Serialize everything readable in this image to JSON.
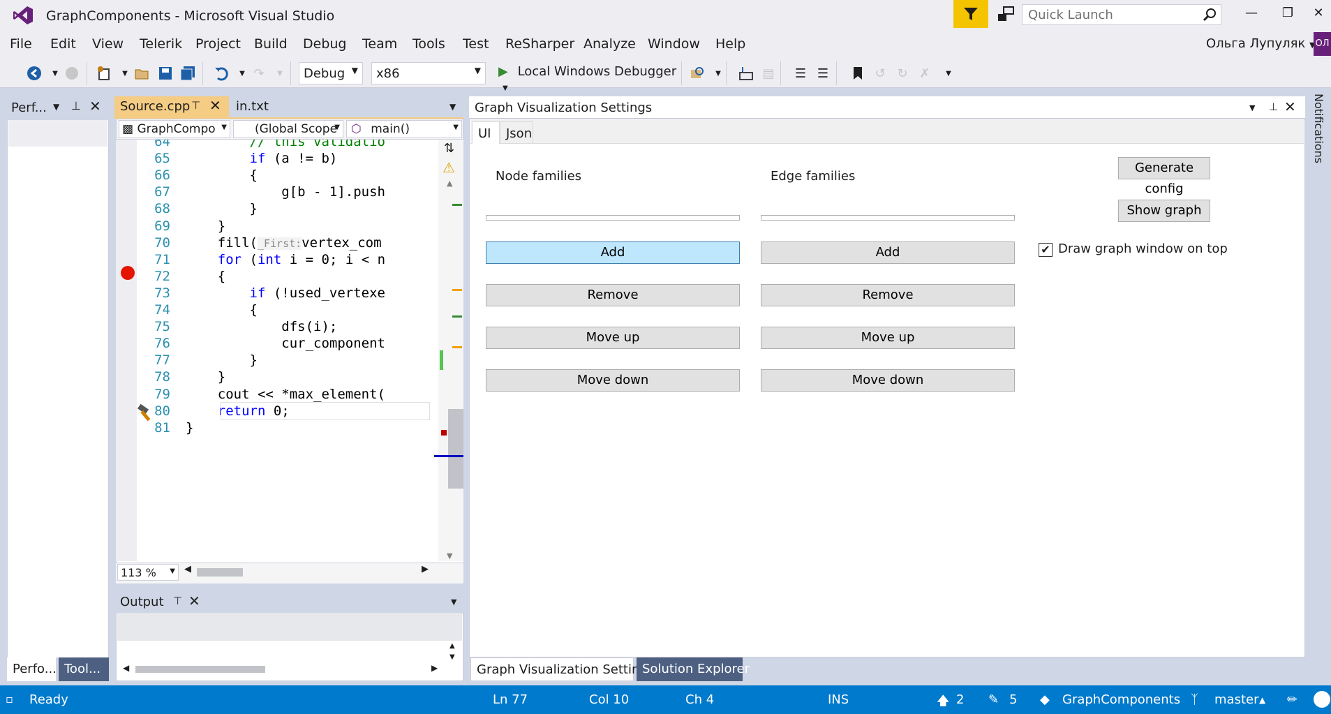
{
  "window": {
    "title": "GraphComponents - Microsoft Visual Studio",
    "quick_launch_placeholder": "Quick Launch",
    "user_name": "Ольга Лупуляк",
    "user_initials": "ОЛ"
  },
  "menu": [
    "File",
    "Edit",
    "View",
    "Telerik",
    "Project",
    "Build",
    "Debug",
    "Team",
    "Tools",
    "Test",
    "ReSharper",
    "Analyze",
    "Window",
    "Help"
  ],
  "toolbar": {
    "config": "Debug",
    "platform": "x86",
    "debugger": "Local Windows Debugger"
  },
  "left_panel": {
    "title": "Perf...",
    "tab_perf": "Perfo...",
    "tab_tool": "Tool..."
  },
  "editor": {
    "tab_active": "Source.cpp",
    "tab_other": "in.txt",
    "nav_project": "GraphCompo",
    "nav_scope": "(Global Scope",
    "nav_member": "main()",
    "zoom": "113 %",
    "lines": [
      {
        "n": "64",
        "code": "        // this validatio"
      },
      {
        "n": "65",
        "code": "        if (a != b)"
      },
      {
        "n": "66",
        "code": "        {"
      },
      {
        "n": "67",
        "code": "            g[b - 1].push"
      },
      {
        "n": "68",
        "code": "        }"
      },
      {
        "n": "69",
        "code": "    }"
      },
      {
        "n": "70",
        "code": "    fill(_First:vertex_com"
      },
      {
        "n": "71",
        "code": "    for (int i = 0; i < n"
      },
      {
        "n": "72",
        "code": "    {"
      },
      {
        "n": "73",
        "code": "        if (!used_vertexe"
      },
      {
        "n": "74",
        "code": "        {"
      },
      {
        "n": "75",
        "code": "            dfs(i);"
      },
      {
        "n": "76",
        "code": "            cur_component"
      },
      {
        "n": "77",
        "code": "        }"
      },
      {
        "n": "78",
        "code": "    }"
      },
      {
        "n": "79",
        "code": "    cout << *max_element("
      },
      {
        "n": "80",
        "code": "    return 0;"
      },
      {
        "n": "81",
        "code": "}"
      }
    ]
  },
  "output": {
    "title": "Output"
  },
  "gvs": {
    "title": "Graph Visualization Settings",
    "tab_ui": "UI",
    "tab_json": "Json",
    "node_families": "Node families",
    "edge_families": "Edge families",
    "add": "Add",
    "remove": "Remove",
    "move_up": "Move up",
    "move_down": "Move down",
    "generate_config": "Generate config",
    "show_graph": "Show graph",
    "draw_on_top": "Draw graph window on top"
  },
  "bottom_tabs": {
    "gvs": "Graph Visualization Settings",
    "solution_explorer": "Solution Explorer"
  },
  "notifications": "Notifications",
  "status": {
    "ready": "Ready",
    "ln": "Ln 77",
    "col": "Col 10",
    "ch": "Ch 4",
    "mode": "INS",
    "push_count": "2",
    "changes_count": "5",
    "repo": "GraphComponents",
    "branch": "master"
  }
}
